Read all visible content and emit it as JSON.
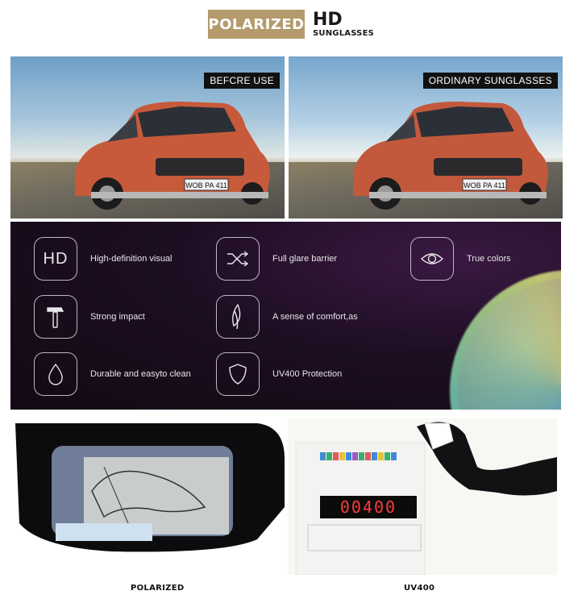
{
  "header": {
    "badge_label": "POLARIZED",
    "hd_label": "HD",
    "sub_label": "SUNGLASSES",
    "badge_color": "#b49a6c"
  },
  "comparison": {
    "left_tag": "BEFCRE USE",
    "right_tag": "ORDINARY SUNGLASSES",
    "plate_text": "WOB PA 411"
  },
  "features": [
    {
      "icon": "hd-icon",
      "icon_text": "HD",
      "label": "High-definition visual"
    },
    {
      "icon": "shuffle-icon",
      "label": "Full glare barrier"
    },
    {
      "icon": "eye-icon",
      "label": "True colors"
    },
    {
      "icon": "hammer-icon",
      "label": "Strong impact"
    },
    {
      "icon": "feather-icon",
      "label": "A sense of comfort,as"
    },
    {
      "icon": "drop-icon",
      "label": "Durable and easyto clean"
    },
    {
      "icon": "shield-icon",
      "label": "UV400 Protection"
    }
  ],
  "demo": {
    "left_caption": "POLARIZED",
    "right_caption": "UV400",
    "meter_reading": "00400"
  }
}
